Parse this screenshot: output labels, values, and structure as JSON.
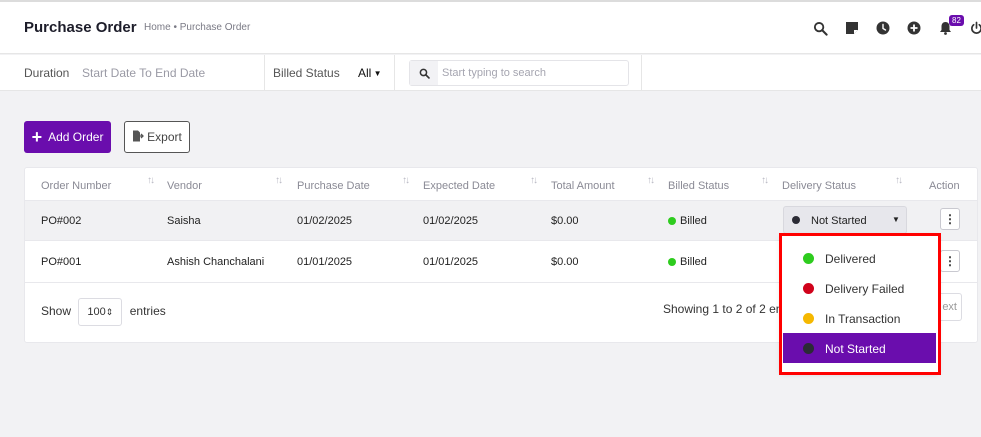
{
  "header": {
    "title": "Purchase Order",
    "breadcrumb": "Home • Purchase Order",
    "notification_count": "82",
    "icons": [
      "search-icon",
      "sticky-note-icon",
      "clock-icon",
      "plus-circle-icon",
      "bell-icon",
      "power-icon"
    ]
  },
  "filters": {
    "duration_label": "Duration",
    "date_range_placeholder": "Start Date To End Date",
    "billed_status_label": "Billed Status",
    "billed_status_value": "All",
    "search_placeholder": "Start typing to search"
  },
  "actions": {
    "add_order_label": "Add Order",
    "export_label": "Export"
  },
  "table": {
    "columns": [
      "Order Number",
      "Vendor",
      "Purchase Date",
      "Expected Date",
      "Total Amount",
      "Billed Status",
      "Delivery Status",
      "Action"
    ],
    "rows": [
      {
        "order_number": "PO#002",
        "vendor": "Saisha",
        "purchase_date": "01/02/2025",
        "expected_date": "01/02/2025",
        "total_amount": "$0.00",
        "billed_status": "Billed",
        "delivery_status": "Not Started"
      },
      {
        "order_number": "PO#001",
        "vendor": "Ashish Chanchalani",
        "purchase_date": "01/01/2025",
        "expected_date": "01/01/2025",
        "total_amount": "$0.00",
        "billed_status": "Billed",
        "delivery_status": ""
      }
    ]
  },
  "footer": {
    "show_label": "Show",
    "entries_value": "100",
    "entries_label": "entries",
    "showing_text": "Showing 1 to 2 of 2 en",
    "next_label": "ext"
  },
  "delivery_dropdown": {
    "options": [
      {
        "label": "Delivered",
        "color": "#2ecc1e"
      },
      {
        "label": "Delivery Failed",
        "color": "#d0021b"
      },
      {
        "label": "In Transaction",
        "color": "#f5b800"
      },
      {
        "label": "Not Started",
        "color": "#2b2b35"
      }
    ],
    "selected": "Not Started"
  },
  "colors": {
    "accent": "#6a0dad",
    "billed_dot": "#2ecc1e",
    "highlight_border": "#ff0000"
  }
}
